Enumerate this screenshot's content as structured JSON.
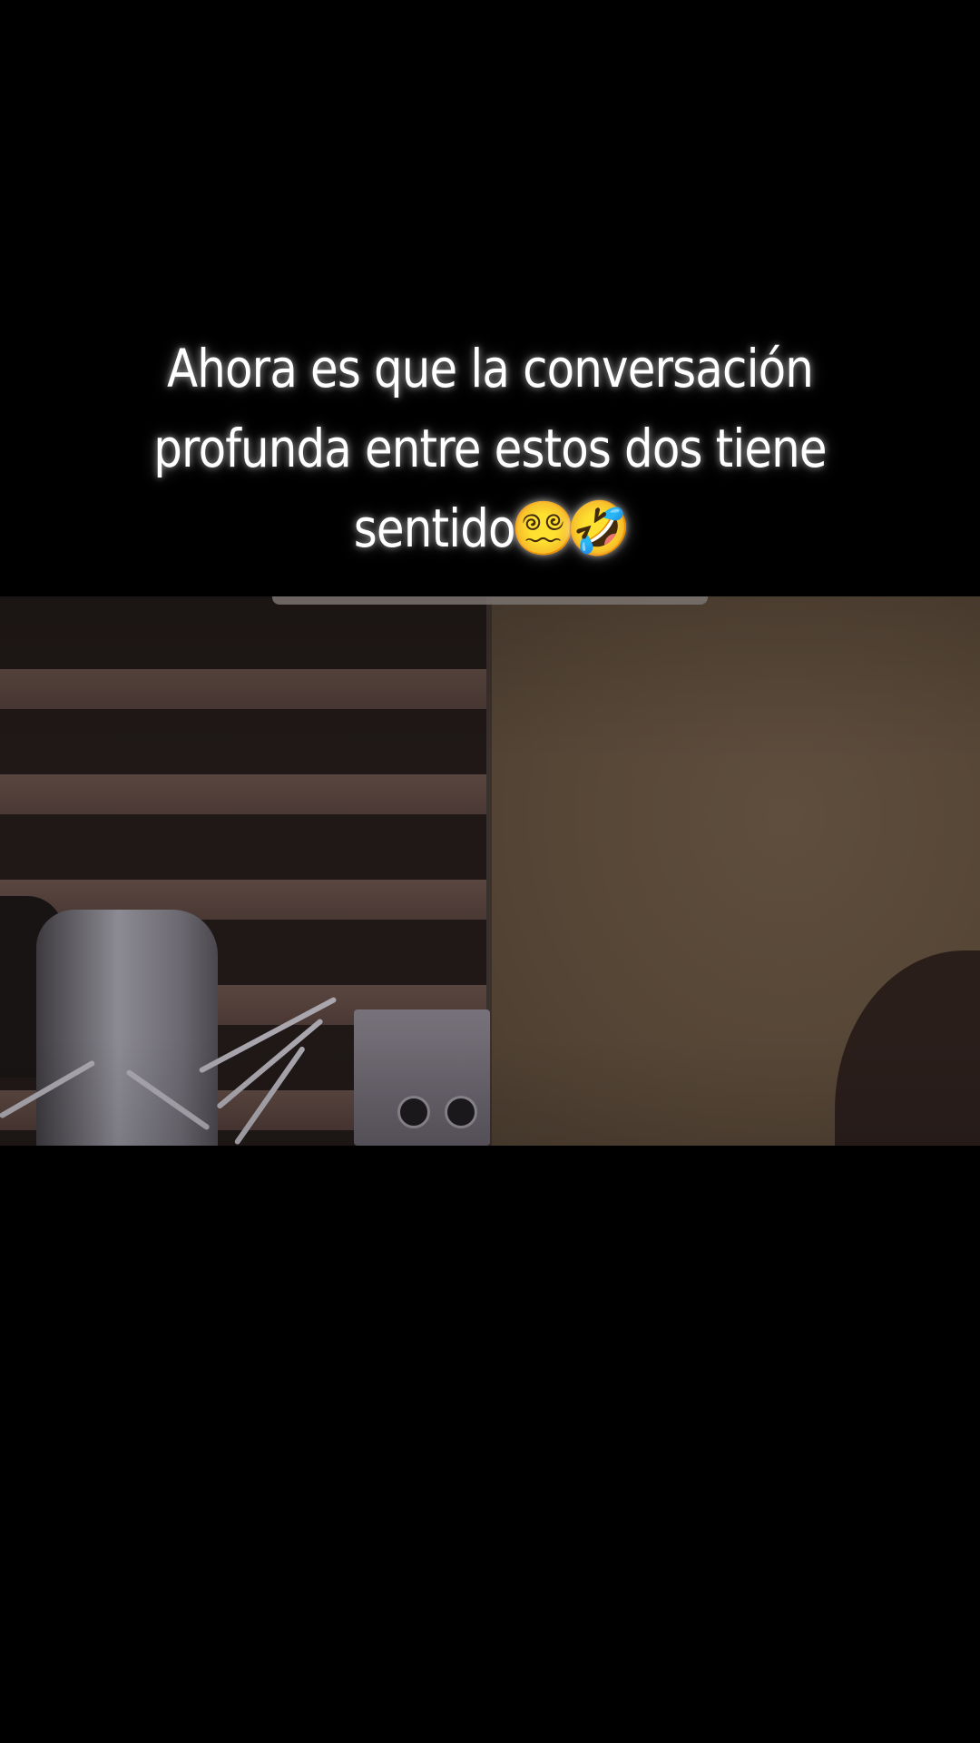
{
  "caption": {
    "line1": "Ahora es que la conversación",
    "line2": "profunda entre estos dos tiene",
    "line3_text": "sentido",
    "emojis": [
      "😵‍💫",
      "🤣"
    ]
  },
  "colors": {
    "background": "#000000",
    "caption_text": "#ffffff",
    "wall_right": "#564636",
    "slats": "#5a4640"
  },
  "icons": {
    "emoji_1": "dizzy-face-emoji",
    "emoji_2": "rolling-laughing-emoji"
  }
}
